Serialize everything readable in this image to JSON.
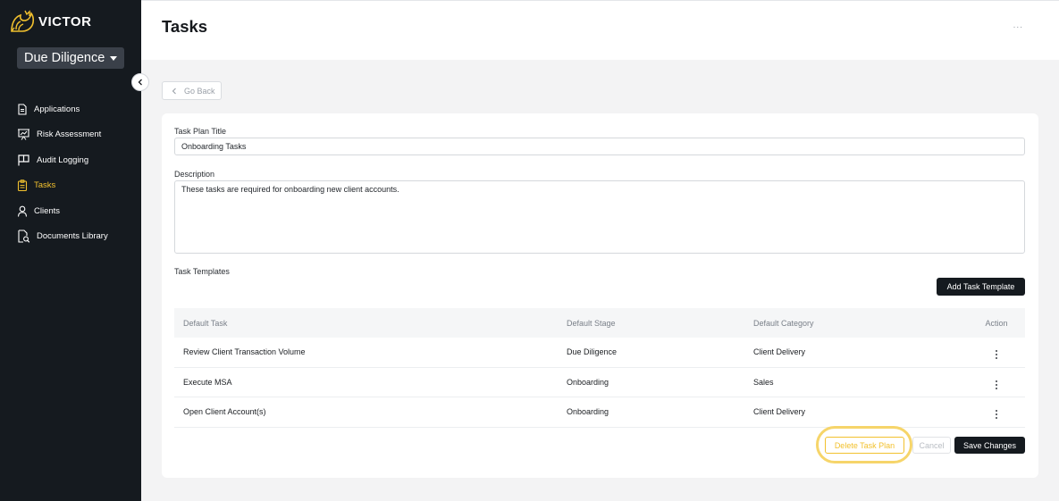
{
  "brand": {
    "name": "VICTOR",
    "accent": "#f2c12e"
  },
  "workspace": {
    "label": "Due Diligence"
  },
  "sidebar": {
    "items": [
      {
        "label": "Applications",
        "icon": "document-icon"
      },
      {
        "label": "Risk Assessment",
        "icon": "presentation-chart-icon"
      },
      {
        "label": "Audit Logging",
        "icon": "flag-icon"
      },
      {
        "label": "Tasks",
        "icon": "clipboard-icon",
        "active": true
      },
      {
        "label": "Clients",
        "icon": "user-icon"
      },
      {
        "label": "Documents Library",
        "icon": "document-search-icon"
      }
    ]
  },
  "header": {
    "title": "Tasks",
    "more": "..."
  },
  "go_back": {
    "label": "Go Back"
  },
  "form": {
    "title_label": "Task Plan Title",
    "title_value": "Onboarding Tasks",
    "description_label": "Description",
    "description_value": "These tasks are required for onboarding new client accounts.",
    "templates_label": "Task Templates",
    "add_template_label": "Add Task Template"
  },
  "table": {
    "headers": [
      "Default Task",
      "Default Stage",
      "Default Category",
      "Action"
    ],
    "rows": [
      {
        "task": "Review Client Transaction Volume",
        "stage": "Due Diligence",
        "category": "Client Delivery"
      },
      {
        "task": "Execute MSA",
        "stage": "Onboarding",
        "category": "Sales"
      },
      {
        "task": "Open Client Account(s)",
        "stage": "Onboarding",
        "category": "Client Delivery"
      }
    ]
  },
  "actions": {
    "delete_label": "Delete Task Plan",
    "cancel_label": "Cancel",
    "save_label": "Save Changes"
  }
}
